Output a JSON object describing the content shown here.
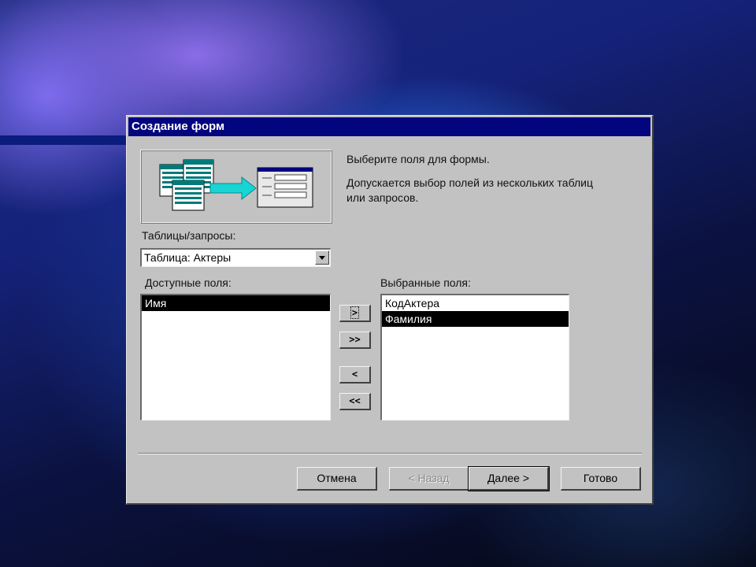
{
  "dialog": {
    "title": "Создание форм",
    "intro_line1": "Выберите поля для формы.",
    "intro_line2": "Допускается выбор полей из нескольких таблиц",
    "intro_line3": "или запросов.",
    "tables_label": "Таблицы/запросы:",
    "tables_value": "Таблица: Актеры",
    "available_label": "Доступные поля:",
    "available_fields": [
      "Имя"
    ],
    "selected_label": "Выбранные поля:",
    "selected_fields": [
      "КодАктера",
      "Фамилия"
    ],
    "move_buttons": {
      "add_one": ">",
      "add_all": ">>",
      "remove_one": "<",
      "remove_all": "<<"
    },
    "buttons": {
      "cancel": "Отмена",
      "back": "< Назад",
      "next": "Далее >",
      "finish": "Готово"
    }
  },
  "colors": {
    "titlebar": "#03057f",
    "dialog_bg": "#c2c2c2",
    "selection": "#000000"
  }
}
